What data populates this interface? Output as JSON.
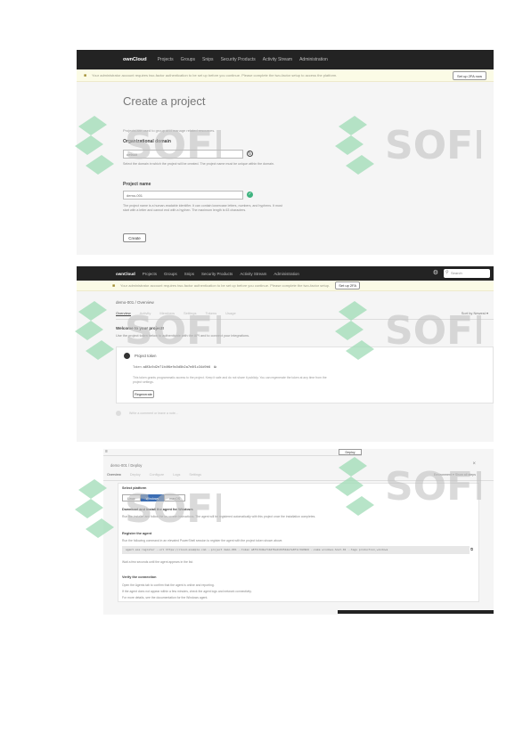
{
  "panel1": {
    "nav": {
      "brand": "ownCloud",
      "items": [
        "Projects",
        "Groups",
        "Snips",
        "Security Products",
        "Activity Stream",
        "Administration"
      ]
    },
    "banner": {
      "text": "Your administrator account requires two-factor authentication to be set up before you continue. Please complete the two-factor setup to access the platform.",
      "button": "Set up 2FA now"
    },
    "title": "Create a project",
    "subtitle": "Projects are used to group and manage related resources.",
    "fields": [
      {
        "label": "Organizational domain",
        "value": "default",
        "help": "Select the domain in which the project will be created. The project name must be unique within the domain."
      },
      {
        "label": "Project name",
        "value": "demo-001",
        "help": "The project name is a human-readable identifier. It can contain lowercase letters, numbers, and hyphens. It must start with a letter and cannot end with a hyphen. The maximum length is 63 characters."
      }
    ],
    "create_button": "Create"
  },
  "panel2": {
    "nav": {
      "brand": "ownCloud",
      "items": [
        "Projects",
        "Groups",
        "Snips",
        "Security Products",
        "Activity Stream",
        "Administration"
      ]
    },
    "search_placeholder": "Search",
    "banner": {
      "text": "Your administrator account requires two-factor authentication to be set up before you continue. Please complete the two-factor setup.",
      "button": "Set up 2FA"
    },
    "breadcrumb": "demo-001 / Overview",
    "tabs": [
      "Overview",
      "Activity",
      "Members",
      "Settings",
      "Tokens",
      "Usage"
    ],
    "right_control": "Sort by Newest ▾",
    "welcome_title": "Welcome to your project!",
    "welcome_sub": "Use the project token below to authenticate with the API and to connect your integrations.",
    "card": {
      "title": "Project token",
      "token_label": "Token:",
      "token": "a8f3c9d2e71b4f6e9c0d5b2a7e8f1c34d9b6",
      "desc": "This token grants programmatic access to the project. Keep it safe and do not share it publicly. You can regenerate the token at any time from the project settings.",
      "button": "Regenerate"
    },
    "comment_placeholder": "Write a comment or leave a note..."
  },
  "panel3": {
    "top_button": "Deploy",
    "breadcrumb": "demo-001 / Deploy",
    "tabs": [
      "Overview",
      "Deploy",
      "Configure",
      "Logs",
      "Settings"
    ],
    "right_control": "Environment ▾   Show all steps",
    "section_title": "Select platform",
    "segments": [
      "Linux",
      "Windows",
      "macOS"
    ],
    "steps": [
      {
        "title": "Download and install the agent for Windows",
        "text": "Run the installer and follow the on-screen instructions. The agent will be registered automatically with this project once the installation completes."
      },
      {
        "title": "Register the agent",
        "text": "Run the following command in an elevated PowerShell session to register the agent with the project token shown above.",
        "code": "agent.exe register --url https://cloud.example.com --project demo-001 --token a8f3c9d2e71b4f6e9c0d5b2a7e8f1c34d9b6 --name windows-host-01 --tags production,windows",
        "note": "Wait a few seconds until the agent appears in the list."
      },
      {
        "title": "Verify the connection",
        "text": "Open the Agents tab to confirm that the agent is online and reporting.",
        "text2": "If the agent does not appear within a few minutes, check the agent logs and network connectivity.",
        "text3": "For more details, see the documentation for the Windows agent."
      }
    ]
  },
  "watermark": "SOFF"
}
